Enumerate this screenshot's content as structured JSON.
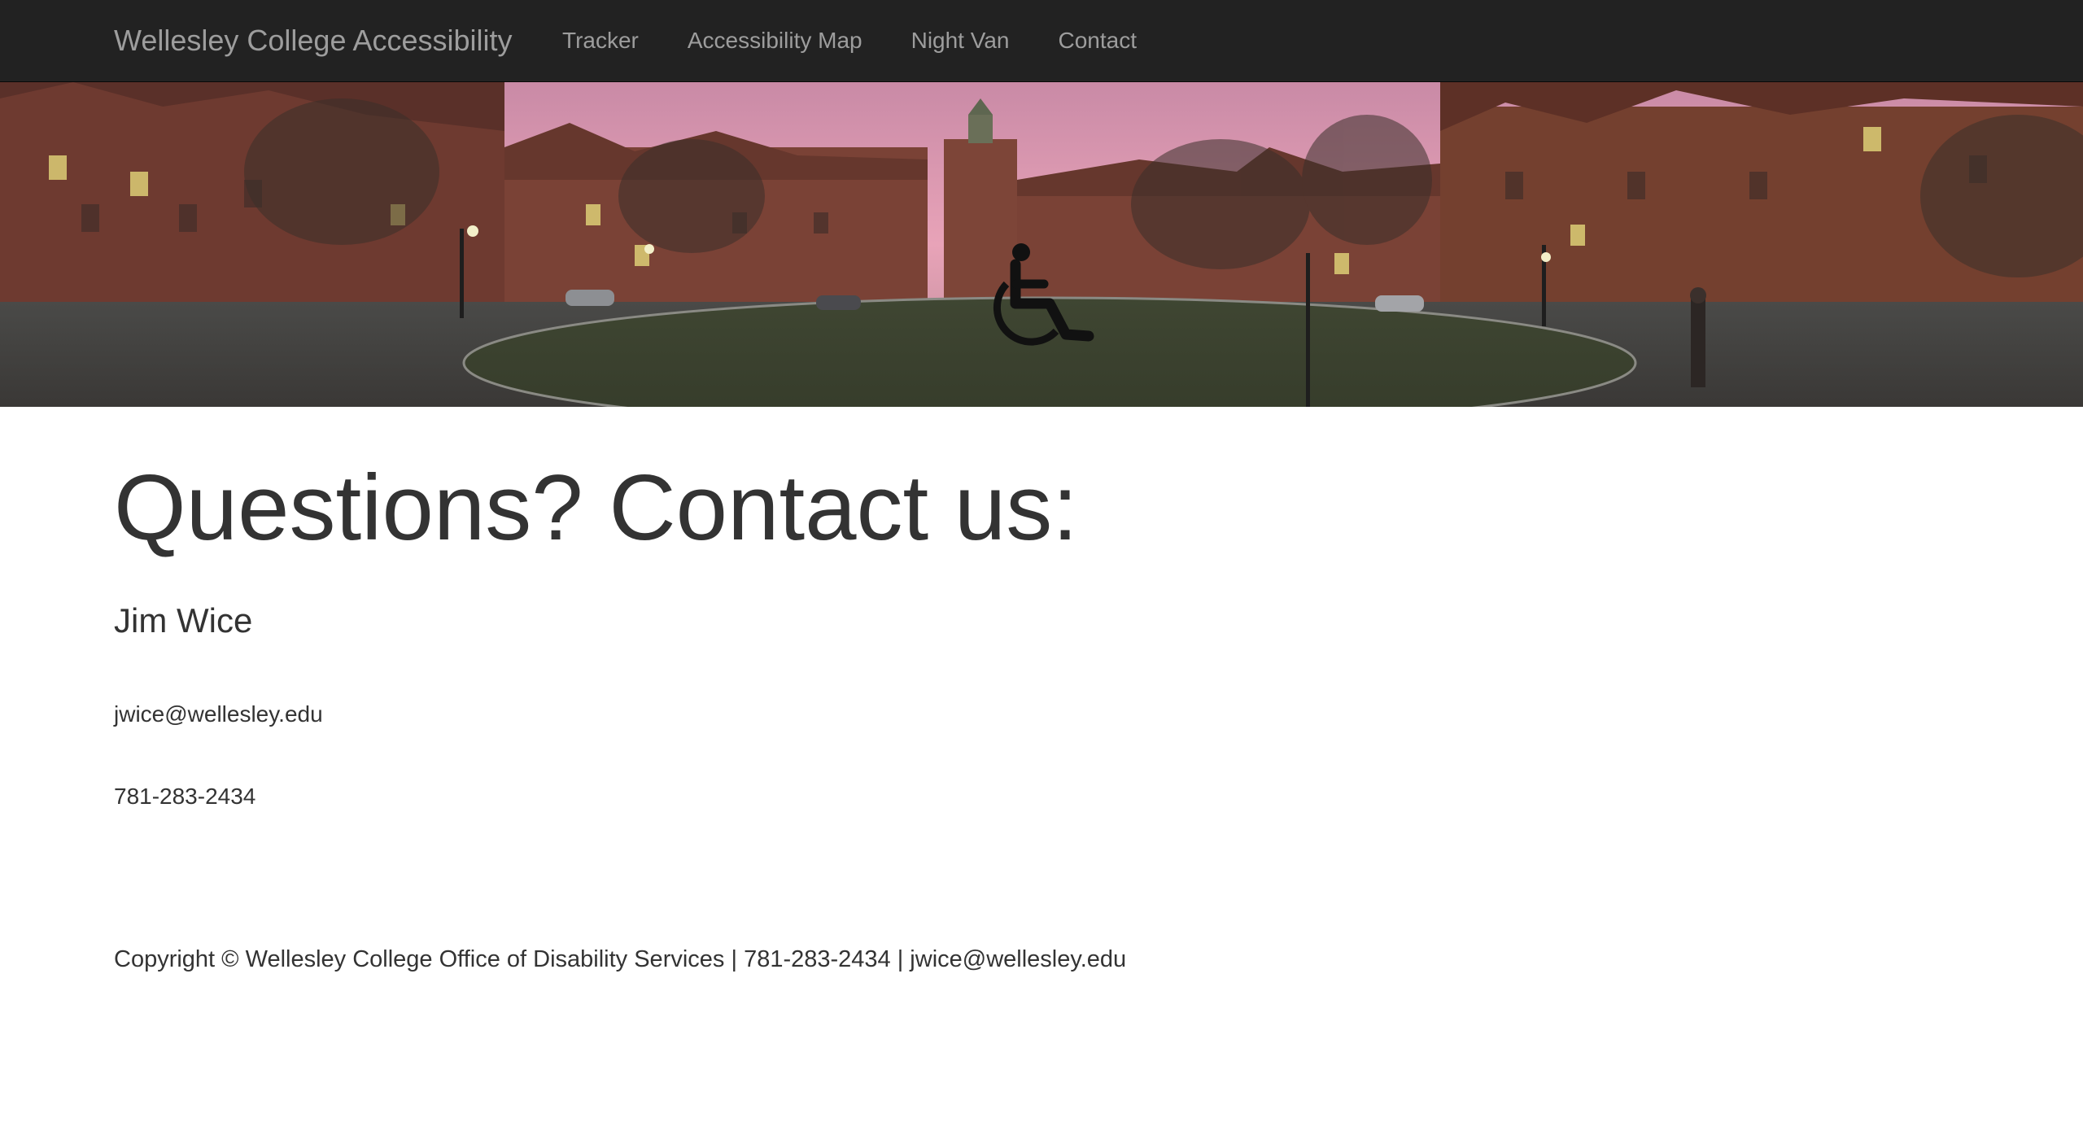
{
  "navbar": {
    "brand": "Wellesley College Accessibility",
    "links": [
      {
        "label": "Tracker"
      },
      {
        "label": "Accessibility Map"
      },
      {
        "label": "Night Van"
      },
      {
        "label": "Contact"
      }
    ]
  },
  "hero": {
    "icon": "wheelchair-accessibility-icon"
  },
  "main": {
    "title": "Questions? Contact us:",
    "contact_name": "Jim Wice",
    "contact_email": "jwice@wellesley.edu",
    "contact_phone": "781-283-2434"
  },
  "footer": {
    "text": "Copyright © Wellesley College Office of Disability Services | 781-283-2434 | jwice@wellesley.edu"
  },
  "colors": {
    "navbar_bg": "#222222",
    "nav_text": "#9d9d9d",
    "body_text": "#333333"
  }
}
